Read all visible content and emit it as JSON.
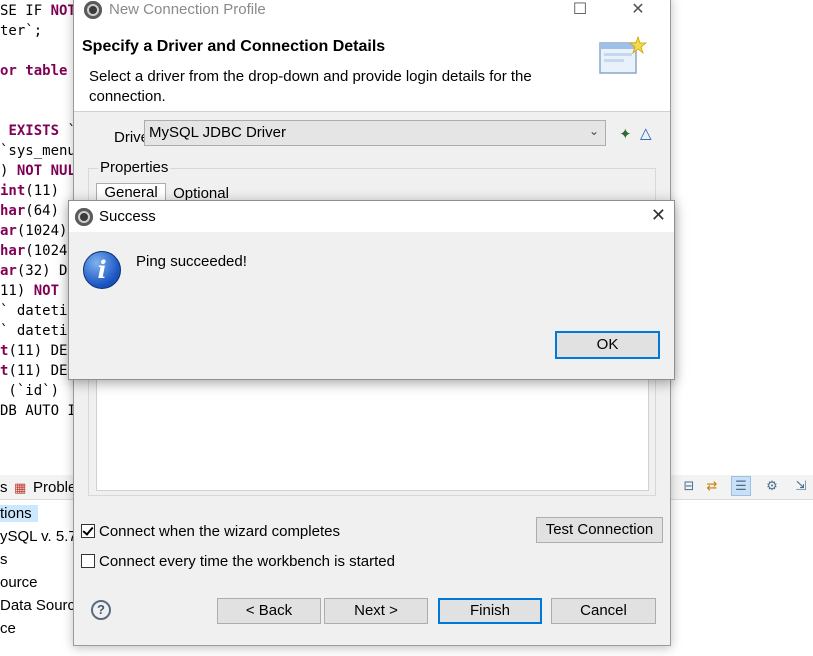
{
  "editor": {
    "lines": [
      {
        "pre": "SE IF ",
        "kw": "NOT",
        "post": ""
      },
      {
        "pre": "ter`;",
        "kw": "",
        "post": ""
      },
      {
        "pre": "",
        "kw": "",
        "post": ""
      },
      {
        "pre": "",
        "kw": "or table",
        "post": ""
      },
      {
        "pre": "",
        "kw": "",
        "post": ""
      },
      {
        "pre": "",
        "kw": "",
        "post": ""
      },
      {
        "pre": " ",
        "kw": "EXISTS",
        "post": " `"
      },
      {
        "pre": "`sys_menu",
        "kw": "",
        "post": ""
      },
      {
        "pre": ") ",
        "kw": "NOT NUL",
        "post": ""
      },
      {
        "pre": "",
        "kw": "int",
        "post": "(11)"
      },
      {
        "pre": "",
        "kw": "har",
        "post": "(64)"
      },
      {
        "pre": "",
        "kw": "ar",
        "post": "(1024)"
      },
      {
        "pre": "",
        "kw": "har",
        "post": "(1024"
      },
      {
        "pre": "",
        "kw": "ar",
        "post": "(32) D"
      },
      {
        "pre": "11) ",
        "kw": "NOT",
        "post": ""
      },
      {
        "pre": "` dateti",
        "kw": "",
        "post": ""
      },
      {
        "pre": "` dateti",
        "kw": "",
        "post": ""
      },
      {
        "pre": "",
        "kw": "t",
        "post": "(11) DE"
      },
      {
        "pre": "",
        "kw": "t",
        "post": "(11) DE"
      },
      {
        "pre": " (`id`)",
        "kw": "",
        "post": ""
      },
      {
        "pre": "DB AUTO I",
        "kw": "",
        "post": ""
      }
    ]
  },
  "views": {
    "tab_fragment": "s",
    "problems_tab": "Proble"
  },
  "tree": {
    "items": [
      "tions",
      "ySQL v. 5.7",
      "s",
      "ource",
      "Data Sourc",
      "ce"
    ]
  },
  "wizard": {
    "window_title": "New Connection Profile",
    "header_title": "Specify a Driver and Connection Details",
    "header_desc": "Select a driver from the drop-down and provide login details for the connection.",
    "drivers_label": "Drivers:",
    "driver_value": "MySQL JDBC Driver",
    "properties_label": "Properties",
    "tab_general": "General",
    "tab_optional": "Optional",
    "connect_on_finish_label": "Connect when the wizard completes",
    "connect_on_finish_checked": true,
    "connect_on_startup_label": "Connect every time the workbench is started",
    "connect_on_startup_checked": false,
    "test_connection_label": "Test Connection",
    "back_label": "< Back",
    "next_label": "Next >",
    "finish_label": "Finish",
    "cancel_label": "Cancel",
    "help_glyph": "?"
  },
  "success_dialog": {
    "title": "Success",
    "message": "Ping succeeded!",
    "ok_label": "OK",
    "info_glyph": "i"
  }
}
